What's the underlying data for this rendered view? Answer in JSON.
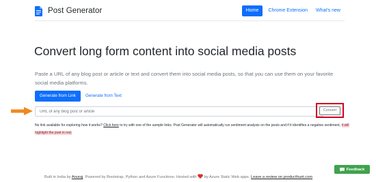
{
  "navbar": {
    "brand": "Post Generator",
    "links": [
      {
        "label": "Home"
      },
      {
        "label": "Chrome Extension"
      },
      {
        "label": "What's new"
      }
    ]
  },
  "hero": {
    "title": "Convert long form content into social media posts",
    "description": "Paste a URL of any blog post or article or text and convert them into social media posts, so that you can use them on your favorite social media platforms."
  },
  "tabs": [
    {
      "label": "Generate from Link"
    },
    {
      "label": "Generate from Text"
    }
  ],
  "form": {
    "url_placeholder": "URL of any blog post or article",
    "convert_label": "Convert"
  },
  "help": {
    "part1": "No link available for exploring how it works? ",
    "link_label": "Click here",
    "part2": " to try with one of the sample links. Post Generator will automatically run sentiment analysis on the posts and if it identifies a negative sentiment, ",
    "highlight": "it will highlight the post in red."
  },
  "footer": {
    "part1": "Built in India by ",
    "author": "Anuraj",
    "part2": ". Powered by Bootstrap, Python and Azure Functions. Hosted with ",
    "part3": " by Azure Static Web apps. ",
    "review": "Leave a review on producthunt.com"
  },
  "feedback": {
    "label": "Feedback"
  },
  "colors": {
    "primary": "#0d6efd",
    "highlight_border": "#d0021b",
    "arrow": "#f0891e",
    "feedback": "#3fa34d",
    "heart": "#d62f2f"
  },
  "icons": {
    "brand": "document-icon",
    "arrow": "arrow-right-icon",
    "heart": "heart-icon",
    "feedback": "chat-icon"
  }
}
